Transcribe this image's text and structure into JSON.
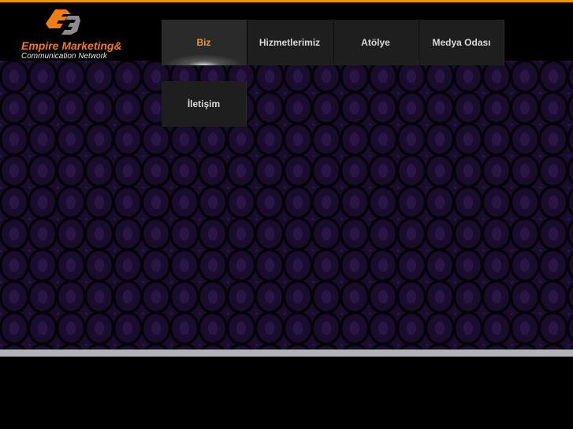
{
  "logo": {
    "line1": "Empire Marketing&",
    "line2": "Communication Network"
  },
  "nav": {
    "items": [
      {
        "label": "Biz",
        "active": true
      },
      {
        "label": "Hizmetlerimiz"
      },
      {
        "label": "Atölye"
      },
      {
        "label": "Medya Odası"
      },
      {
        "label": "İletişim"
      }
    ]
  },
  "colors": {
    "accent": "#f39200",
    "background": "#1a0c2c"
  }
}
